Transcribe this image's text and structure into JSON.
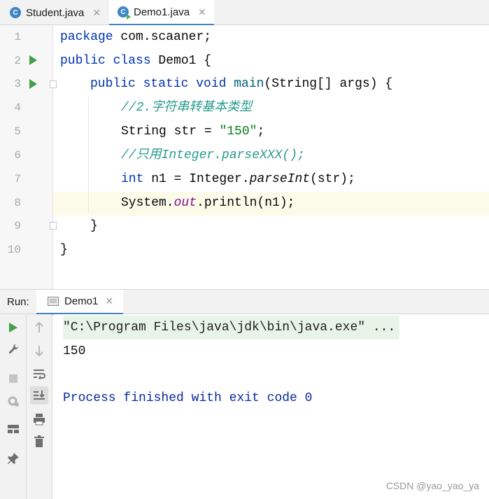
{
  "tabs": [
    {
      "label": "Student.java",
      "icon": "class-c-icon",
      "active": false
    },
    {
      "label": "Demo1.java",
      "icon": "class-run-icon",
      "active": true
    }
  ],
  "editor": {
    "current_line": 8,
    "lines": [
      {
        "num": "1"
      },
      {
        "num": "2"
      },
      {
        "num": "3"
      },
      {
        "num": "4"
      },
      {
        "num": "5"
      },
      {
        "num": "6"
      },
      {
        "num": "7"
      },
      {
        "num": "8"
      },
      {
        "num": "9"
      },
      {
        "num": "10"
      }
    ],
    "code": {
      "l1_kw": "package",
      "l1_rest": " com.scaaner;",
      "l2_kw": "public class",
      "l2_rest": " Demo1 {",
      "l3_kw": "public static void",
      "l3_fn": "main",
      "l3_rest": "(String[] args) {",
      "l4_cmt": "//2.字符串转基本类型",
      "l5_a": "String str = ",
      "l5_str": "\"150\"",
      "l5_b": ";",
      "l6_cmt": "//只用Integer.parseXXX();",
      "l7_kw": "int",
      "l7_a": " n1 = Integer.",
      "l7_it": "parseInt",
      "l7_b": "(str);",
      "l8_a": "System.",
      "l8_fld": "out",
      "l8_b": ".println(n1);",
      "l9": "}",
      "l10": "}"
    }
  },
  "run_panel": {
    "label": "Run:",
    "tab_label": "Demo1",
    "console_lines": {
      "cmd": "\"C:\\Program Files\\java\\jdk\\bin\\java.exe\" ...",
      "output": "150",
      "finished": "Process finished with exit code 0"
    },
    "left_tools": [
      "run-icon",
      "wrench-icon",
      "stop-icon",
      "debug-settings-icon",
      "layout-icon",
      "pin-icon"
    ],
    "right_tools": [
      "up-arrow-icon",
      "down-arrow-icon",
      "soft-wrap-icon",
      "scroll-to-end-icon",
      "print-icon",
      "trash-icon"
    ]
  },
  "watermark": "CSDN @yao_yao_ya",
  "colors": {
    "keyword": "#0033b3",
    "string": "#067d17",
    "comment": "#289b8d",
    "static_field": "#871094",
    "run_green": "#43a047",
    "exit_text": "#0b2b9b"
  }
}
